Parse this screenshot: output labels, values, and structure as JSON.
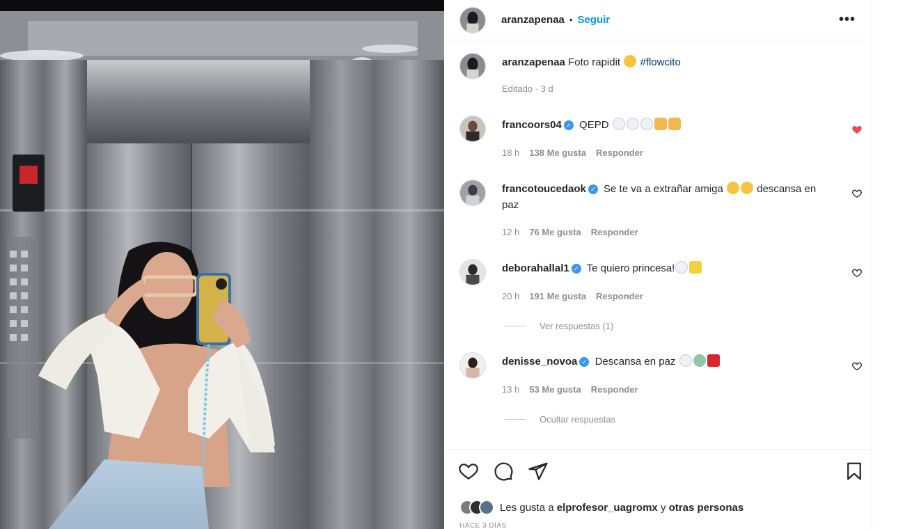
{
  "post": {
    "author": "aranzapenaa",
    "separator": "•",
    "follow_label": "Seguir",
    "more_label": "•••",
    "caption": {
      "username": "aranzapenaa",
      "text": "Foto rapidit",
      "emoji": "laughing-face",
      "hashtag": "#flowcito",
      "meta": "Editado · 3 d"
    }
  },
  "comments": [
    {
      "username": "francoors04",
      "verified": true,
      "text": "QEPD",
      "emojis": [
        "dove",
        "dove",
        "dove",
        "folded-hands",
        "folded-hands"
      ],
      "age": "18 h",
      "likes": "138 Me gusta",
      "reply": "Responder",
      "liked": true
    },
    {
      "username": "francotoucedaok",
      "verified": true,
      "text": "Se te va a extrañar amiga",
      "text_after": "descansa en paz",
      "emojis": [
        "sad-face",
        "sad-face"
      ],
      "age": "12 h",
      "likes": "76 Me gusta",
      "reply": "Responder",
      "liked": false
    },
    {
      "username": "deborahallal1",
      "verified": true,
      "text": "Te quiero princesa!",
      "emojis": [
        "dove",
        "sparkle-star"
      ],
      "age": "20 h",
      "likes": "191 Me gusta",
      "reply": "Responder",
      "liked": false,
      "thread": "Ver respuestas (1)"
    },
    {
      "username": "denisse_novoa",
      "verified": true,
      "text": "Descansa en paz",
      "emojis": [
        "dove",
        "angel-face",
        "red-heart"
      ],
      "age": "13 h",
      "likes": "53 Me gusta",
      "reply": "Responder",
      "liked": false,
      "thread": "Ocultar respuestas"
    }
  ],
  "actions": {
    "like_icon": "heart-icon",
    "comment_icon": "comment-icon",
    "share_icon": "share-icon",
    "save_icon": "bookmark-icon"
  },
  "likes_summary": {
    "prefix": "Les gusta a",
    "user": "elprofesor_uagromx",
    "conjunction": "y",
    "others": "otras personas"
  },
  "post_age": "HACE 3 DÍAS",
  "colors": {
    "accent": "#0095f6",
    "liked_heart": "#ed4956",
    "verified": "#3897f0",
    "muted_text": "#8e8e8e"
  }
}
